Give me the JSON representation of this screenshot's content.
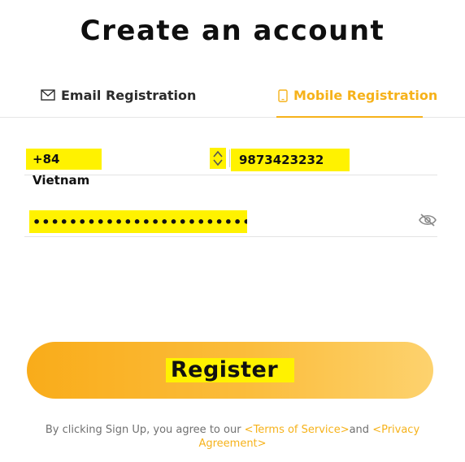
{
  "page": {
    "title": "Create an account"
  },
  "tabs": [
    {
      "label": "Email Registration",
      "icon": "envelope-icon",
      "active": false
    },
    {
      "label": "Mobile Registration",
      "icon": "smartphone-icon",
      "active": true
    }
  ],
  "form": {
    "country_code": "+84 Vietnam",
    "phone_value": "9873423232",
    "password_value": "••••••••••••••••••••••••"
  },
  "register_button": {
    "label": "Register"
  },
  "terms": {
    "prefix": "By clicking Sign Up, you agree to our ",
    "terms_link": "<Terms of Service>",
    "joiner": "and ",
    "privacy_link": "<Privacy Agreement>"
  },
  "colors": {
    "accent": "#f6b21a",
    "highlight": "#fff200",
    "button_gradient_start": "#f9ac1a",
    "button_gradient_end": "#fdd26e"
  }
}
